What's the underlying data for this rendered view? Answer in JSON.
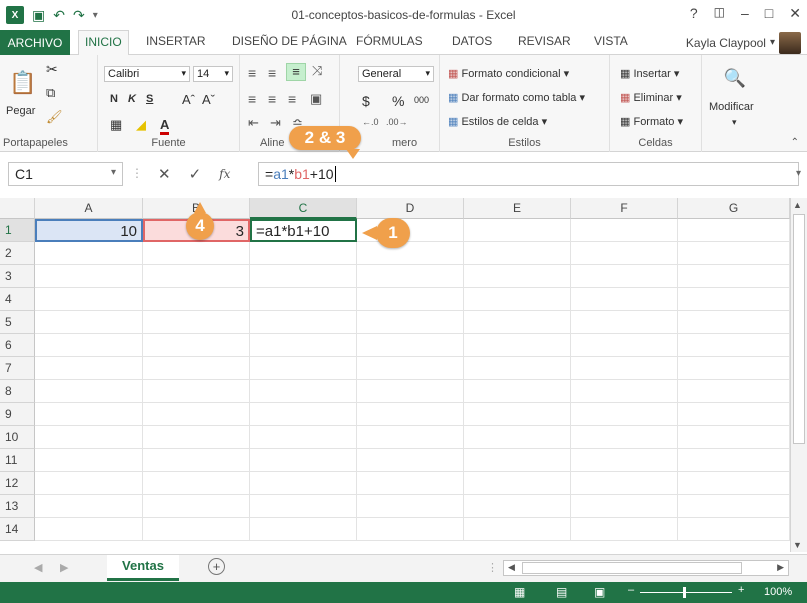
{
  "window": {
    "title": "01-conceptos-basicos-de-formulas - Excel",
    "help": "?",
    "minimize": "–",
    "restore": "□",
    "close": "✕"
  },
  "qat": {
    "logo": "X",
    "save": "💾",
    "undo": "↶",
    "redo": "↷"
  },
  "tabs": [
    "ARCHIVO",
    "INICIO",
    "INSERTAR",
    "DISEÑO DE PÁGINA",
    "FÓRMULAS",
    "DATOS",
    "REVISAR",
    "VISTA"
  ],
  "user": {
    "name": "Kayla Claypool"
  },
  "ribbon": {
    "clipboard": {
      "label": "Portapapeles",
      "paste": "Pegar"
    },
    "font": {
      "label": "Fuente",
      "name": "Calibri",
      "size": "14",
      "bold": "N",
      "italic": "K",
      "underline": "S"
    },
    "alignment": {
      "label": "Aline"
    },
    "number": {
      "label": "mero",
      "format": "General",
      "currency": "$",
      "percent": "%",
      "thousands": "000"
    },
    "styles": {
      "label": "Estilos",
      "cond": "Formato condicional",
      "table": "Dar formato como tabla",
      "cell": "Estilos de celda"
    },
    "cells": {
      "label": "Celdas",
      "insert": "Insertar",
      "delete": "Eliminar",
      "format": "Formato"
    },
    "editing": {
      "modify": "Modificar"
    }
  },
  "formula_bar": {
    "name_box": "C1",
    "cancel": "✕",
    "enter": "✓",
    "fx": "fx",
    "formula": "=a1*b1+10",
    "formula_parts": [
      "=",
      "a1",
      "*",
      "b1",
      "+10"
    ]
  },
  "grid": {
    "columns": [
      "A",
      "B",
      "C",
      "D",
      "E",
      "F",
      "G"
    ],
    "rows": [
      "1",
      "2",
      "3",
      "4",
      "5",
      "6",
      "7",
      "8",
      "9",
      "10",
      "11",
      "12",
      "13",
      "14"
    ],
    "cells": {
      "A1": "10",
      "B1": "3",
      "C1": "=a1*b1+10"
    }
  },
  "sheet": {
    "tab": "Ventas",
    "add": "+"
  },
  "status": {
    "zoom": "100%"
  },
  "callouts": {
    "c1": "1",
    "c23": "2 & 3",
    "c4": "4"
  },
  "colors": {
    "excel_green": "#217346",
    "callout": "#f0a04b",
    "ref_blue": "#4a7ebb",
    "ref_red": "#e06666"
  }
}
